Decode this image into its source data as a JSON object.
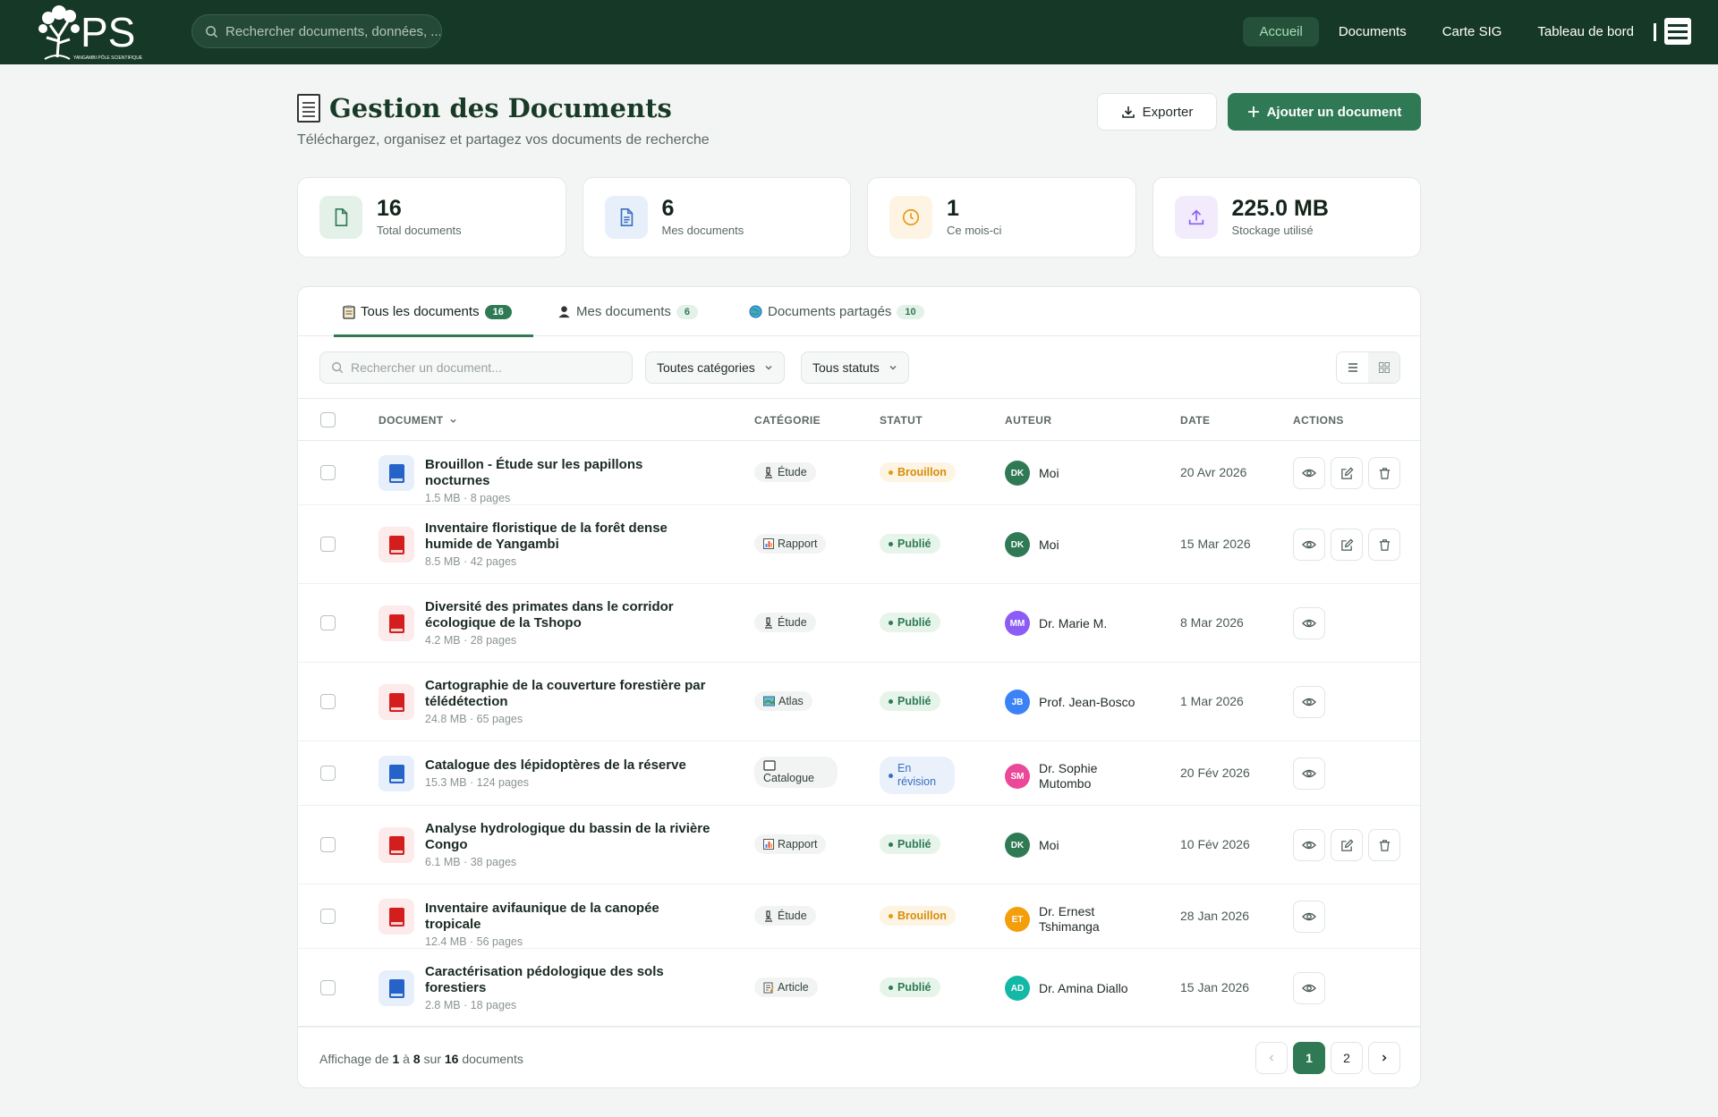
{
  "nav": {
    "logo_text": "PS",
    "logo_subtext": "YANGAMBI PÔLE SCIENTIFIQUE",
    "search_placeholder": "Rechercher documents, données, ...",
    "links": [
      {
        "label": "Accueil",
        "active": true
      },
      {
        "label": "Documents",
        "active": false
      },
      {
        "label": "Carte SIG",
        "active": false
      },
      {
        "label": "Tableau de bord",
        "active": false
      }
    ]
  },
  "header": {
    "title": "Gestion des Documents",
    "subtitle": "Téléchargez, organisez et partagez vos documents de recherche",
    "export_label": "Exporter",
    "add_label": "Ajouter un document"
  },
  "stats": [
    {
      "value": "16",
      "label": "Total documents",
      "icon": "file-icon"
    },
    {
      "value": "6",
      "label": "Mes documents",
      "icon": "file-text-icon"
    },
    {
      "value": "1",
      "label": "Ce mois-ci",
      "icon": "clock-icon"
    },
    {
      "value": "225.0 MB",
      "label": "Stockage utilisé",
      "icon": "upload-icon"
    }
  ],
  "tabs": [
    {
      "label": "Tous les documents",
      "count": "16",
      "active": true
    },
    {
      "label": "Mes documents",
      "count": "6",
      "active": false
    },
    {
      "label": "Documents partagés",
      "count": "10",
      "active": false
    }
  ],
  "filters": {
    "search_placeholder": "Rechercher un document...",
    "category": "Toutes catégories",
    "status": "Tous statuts"
  },
  "table": {
    "headers": {
      "document": "DOCUMENT",
      "category": "CATÉGORIE",
      "status": "STATUT",
      "author": "AUTEUR",
      "date": "DATE",
      "actions": "ACTIONS"
    },
    "rows": [
      {
        "title": "Brouillon - Étude sur les papillons nocturnes",
        "meta": "1.5 MB · 8 pages",
        "color": "blue",
        "category": "Étude",
        "status": "Brouillon",
        "status_type": "bro",
        "initials": "DK",
        "av_color": "#2f7a55",
        "author": "Moi",
        "date": "20 Avr 2026",
        "owner": true
      },
      {
        "title": "Inventaire floristique de la forêt dense humide de Yangambi",
        "meta": "8.5 MB · 42 pages",
        "color": "red",
        "category": "Rapport",
        "status": "Publié",
        "status_type": "pub",
        "initials": "DK",
        "av_color": "#2f7a55",
        "author": "Moi",
        "date": "15 Mar 2026",
        "owner": true
      },
      {
        "title": "Diversité des primates dans le corridor écologique de la Tshopo",
        "meta": "4.2 MB · 28 pages",
        "color": "red",
        "category": "Étude",
        "status": "Publié",
        "status_type": "pub",
        "initials": "MM",
        "av_color": "#8b5cf6",
        "author": "Dr. Marie M.",
        "date": "8 Mar 2026",
        "owner": false
      },
      {
        "title": "Cartographie de la couverture forestière par télédétection",
        "meta": "24.8 MB · 65 pages",
        "color": "red",
        "category": "Atlas",
        "status": "Publié",
        "status_type": "pub",
        "initials": "JB",
        "av_color": "#3b82f6",
        "author": "Prof. Jean-Bosco",
        "date": "1 Mar 2026",
        "owner": false
      },
      {
        "title": "Catalogue des lépidoptères de la réserve",
        "meta": "15.3 MB · 124 pages",
        "color": "blue",
        "category": "Catalogue",
        "status": "En révision",
        "status_type": "rev",
        "initials": "SM",
        "av_color": "#ec4899",
        "author": "Dr. Sophie Mutombo",
        "date": "20 Fév 2026",
        "owner": false
      },
      {
        "title": "Analyse hydrologique du bassin de la rivière Congo",
        "meta": "6.1 MB · 38 pages",
        "color": "red",
        "category": "Rapport",
        "status": "Publié",
        "status_type": "pub",
        "initials": "DK",
        "av_color": "#2f7a55",
        "author": "Moi",
        "date": "10 Fév 2026",
        "owner": true
      },
      {
        "title": "Inventaire avifaunique de la canopée tropicale",
        "meta": "12.4 MB · 56 pages",
        "color": "red",
        "category": "Étude",
        "status": "Brouillon",
        "status_type": "bro",
        "initials": "ET",
        "av_color": "#f59e0b",
        "author": "Dr. Ernest Tshimanga",
        "date": "28 Jan 2026",
        "owner": false
      },
      {
        "title": "Caractérisation pédologique des sols forestiers",
        "meta": "2.8 MB · 18 pages",
        "color": "blue",
        "category": "Article",
        "status": "Publié",
        "status_type": "pub",
        "initials": "AD",
        "av_color": "#14b8a6",
        "author": "Dr. Amina Diallo",
        "date": "15 Jan 2026",
        "owner": false
      }
    ]
  },
  "footer": {
    "prefix": "Affichage de",
    "from": "1",
    "to_word": "à",
    "to": "8",
    "of_word": "sur",
    "total": "16",
    "suffix": "documents",
    "pages": [
      "1",
      "2"
    ]
  }
}
